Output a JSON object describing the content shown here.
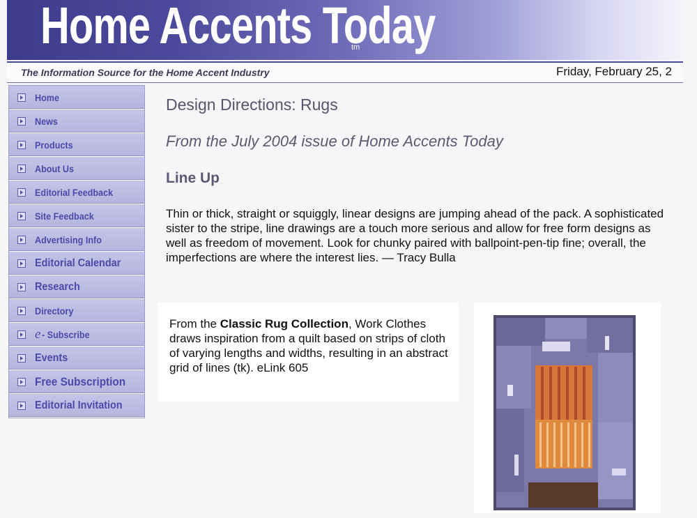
{
  "header": {
    "title": "Home Accents Today",
    "trademark": "tm",
    "tagline": "The Information Source for the Home Accent Industry",
    "date": "Friday, February 25, 2"
  },
  "sidebar": {
    "items": [
      {
        "label": "Home"
      },
      {
        "label": "News"
      },
      {
        "label": "Products"
      },
      {
        "label": "About Us"
      },
      {
        "label": "Editorial Feedback"
      },
      {
        "label": "Site Feedback"
      },
      {
        "label": "Advertising Info"
      },
      {
        "label": "Editorial Calendar"
      },
      {
        "label": "Research"
      },
      {
        "label": "Directory"
      },
      {
        "label": "- Subscribe",
        "prefix": "e"
      },
      {
        "label": "Events"
      },
      {
        "label": "Free Subscription"
      },
      {
        "label": "Editorial Invitation"
      }
    ]
  },
  "article": {
    "heading": "Design Directions: Rugs",
    "issue": "From the July 2004 issue of Home Accents Today",
    "subheading": "Line Up",
    "body": "Thin or thick, straight or squiggly, linear designs are jumping ahead of the pack. A sophisticated sister to the stripe, line drawings are a touch more serious and allow for free form designs as well as freedom of movement. Look for chunky paired with ballpoint-pen-tip fine; overall, the imperfections are where the interest lies. — Tracy Bulla"
  },
  "feature": {
    "caption_before": "From the ",
    "collection": "Classic Rug Collection",
    "caption_after": ", Work Clothes draws inspiration from a quilt based on strips of cloth of varying lengths and widths, resulting in an abstract grid of lines (tk). eLink 605"
  },
  "colors": {
    "banner": "#3d3c8c",
    "sidebar": "#b9b9e2",
    "nav_text": "#4a4aa8",
    "rug_orange": "#d67a3c"
  }
}
